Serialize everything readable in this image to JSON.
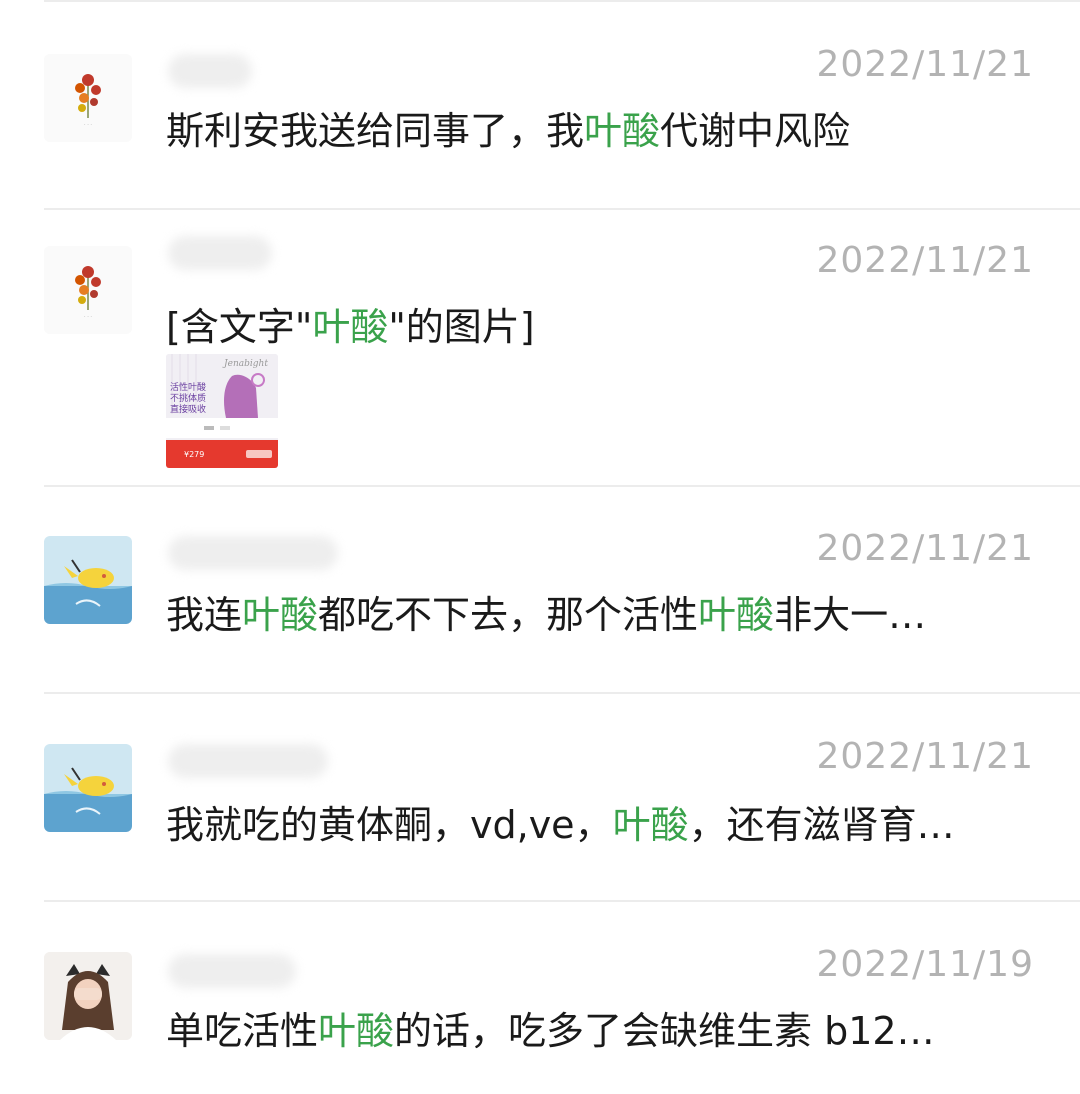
{
  "results": [
    {
      "date": "2022/11/21",
      "parts": [
        {
          "t": "斯利安我送给同事了，我",
          "hl": false
        },
        {
          "t": "叶酸",
          "hl": true
        },
        {
          "t": "代谢中风险",
          "hl": false
        }
      ]
    },
    {
      "date": "2022/11/21",
      "parts": [
        {
          "t": "[含文字\"",
          "hl": false
        },
        {
          "t": "叶酸",
          "hl": true
        },
        {
          "t": "\"的图片]",
          "hl": false
        }
      ],
      "thumbnail": {
        "brand": "Jenabight",
        "lines": [
          "活性叶酸",
          "不挑体质",
          "直接吸收"
        ],
        "price": "¥279"
      }
    },
    {
      "date": "2022/11/21",
      "parts": [
        {
          "t": "我连",
          "hl": false
        },
        {
          "t": "叶酸",
          "hl": true
        },
        {
          "t": "都吃不下去，那个活性",
          "hl": false
        },
        {
          "t": "叶酸",
          "hl": true
        },
        {
          "t": "非大一…",
          "hl": false
        }
      ]
    },
    {
      "date": "2022/11/21",
      "parts": [
        {
          "t": "我就吃的黄体酮，vd,ve，",
          "hl": false
        },
        {
          "t": "叶酸",
          "hl": true
        },
        {
          "t": "，还有滋肾育…",
          "hl": false
        }
      ]
    },
    {
      "date": "2022/11/19",
      "parts": [
        {
          "t": "单吃活性",
          "hl": false
        },
        {
          "t": "叶酸",
          "hl": true
        },
        {
          "t": "的话，吃多了会缺维生素 b12…",
          "hl": false
        }
      ]
    }
  ],
  "colors": {
    "highlight": "#3aa24b",
    "date": "#b3b3b3",
    "text": "#1a1a1a",
    "divider": "#ececec"
  },
  "icons": {
    "avatar_1": "flower-bouquet-avatar",
    "avatar_2": "flower-bouquet-avatar",
    "avatar_3": "pikachu-seaside-avatar",
    "avatar_4": "pikachu-seaside-avatar",
    "avatar_5": "girl-covering-face-avatar"
  }
}
